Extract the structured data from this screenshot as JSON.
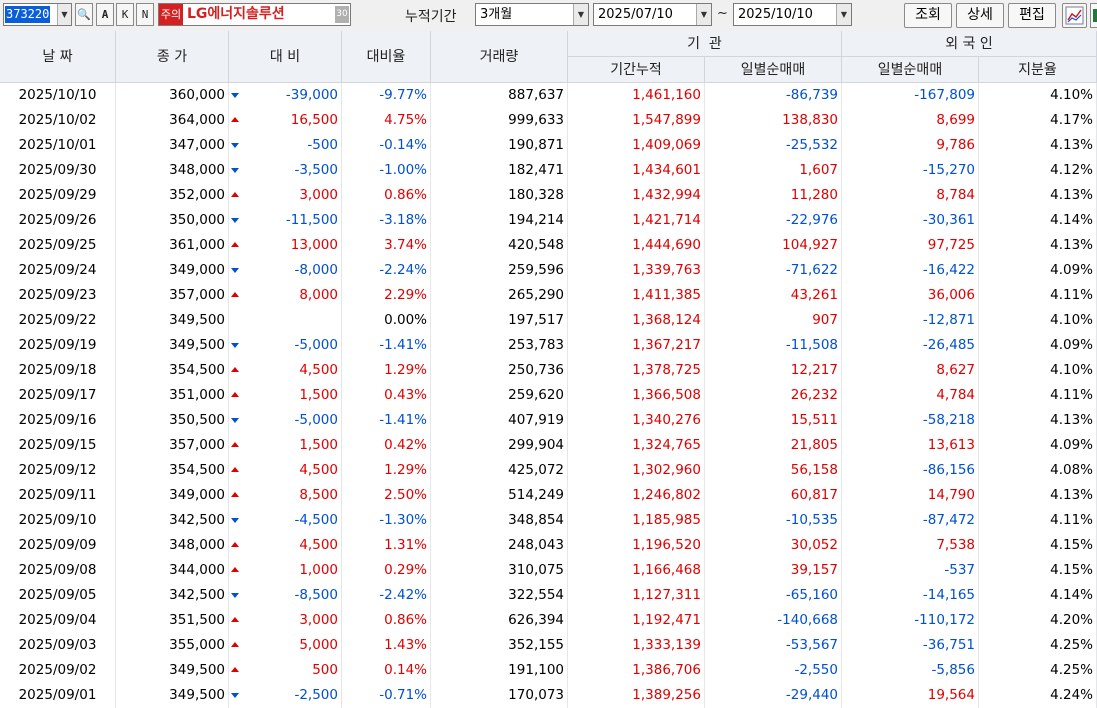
{
  "toolbar": {
    "code": "373220",
    "buttons": {
      "search": "🔍",
      "a": "A",
      "k": "K",
      "n": "N"
    },
    "caution": "주의",
    "name": "LG에너지솔루션",
    "name_btn": "30",
    "period_label": "누적기간",
    "period": "3개월",
    "start_date": "2025/07/10",
    "tilde": "~",
    "end_date": "2025/10/10",
    "query": "조회",
    "detail": "상세",
    "edit": "편집"
  },
  "colors": {
    "up": "#e00000",
    "down": "#0050d0",
    "header_bg": "#eef1f5"
  },
  "headers": {
    "date": "날 짜",
    "close": "종 가",
    "change": "대 비",
    "rate": "대비율",
    "volume": "거래량",
    "inst": "기  관",
    "inst_cum": "기간누적",
    "inst_daily": "일별순매매",
    "foreign": "외 국 인",
    "frgn_daily": "일별순매매",
    "frgn_share": "지분율"
  },
  "rows": [
    {
      "d": "2025/10/10",
      "c": "360,000",
      "dir": "down",
      "chg": "-39,000",
      "r": "-9.77%",
      "v": "887,637",
      "ic": "1,461,160",
      "id": "-86,739",
      "fd": "-167,809",
      "fs": "4.10%"
    },
    {
      "d": "2025/10/02",
      "c": "364,000",
      "dir": "up",
      "chg": "16,500",
      "r": "4.75%",
      "v": "999,633",
      "ic": "1,547,899",
      "id": "138,830",
      "fd": "8,699",
      "fs": "4.17%"
    },
    {
      "d": "2025/10/01",
      "c": "347,000",
      "dir": "down",
      "chg": "-500",
      "r": "-0.14%",
      "v": "190,871",
      "ic": "1,409,069",
      "id": "-25,532",
      "fd": "9,786",
      "fs": "4.13%"
    },
    {
      "d": "2025/09/30",
      "c": "348,000",
      "dir": "down",
      "chg": "-3,500",
      "r": "-1.00%",
      "v": "182,471",
      "ic": "1,434,601",
      "id": "1,607",
      "fd": "-15,270",
      "fs": "4.12%"
    },
    {
      "d": "2025/09/29",
      "c": "352,000",
      "dir": "up",
      "chg": "3,000",
      "r": "0.86%",
      "v": "180,328",
      "ic": "1,432,994",
      "id": "11,280",
      "fd": "8,784",
      "fs": "4.13%"
    },
    {
      "d": "2025/09/26",
      "c": "350,000",
      "dir": "down",
      "chg": "-11,500",
      "r": "-3.18%",
      "v": "194,214",
      "ic": "1,421,714",
      "id": "-22,976",
      "fd": "-30,361",
      "fs": "4.14%"
    },
    {
      "d": "2025/09/25",
      "c": "361,000",
      "dir": "up",
      "chg": "13,000",
      "r": "3.74%",
      "v": "420,548",
      "ic": "1,444,690",
      "id": "104,927",
      "fd": "97,725",
      "fs": "4.13%"
    },
    {
      "d": "2025/09/24",
      "c": "349,000",
      "dir": "down",
      "chg": "-8,000",
      "r": "-2.24%",
      "v": "259,596",
      "ic": "1,339,763",
      "id": "-71,622",
      "fd": "-16,422",
      "fs": "4.09%"
    },
    {
      "d": "2025/09/23",
      "c": "357,000",
      "dir": "up",
      "chg": "8,000",
      "r": "2.29%",
      "v": "265,290",
      "ic": "1,411,385",
      "id": "43,261",
      "fd": "36,006",
      "fs": "4.11%"
    },
    {
      "d": "2025/09/22",
      "c": "349,500",
      "dir": "none",
      "chg": "",
      "r": "0.00%",
      "v": "197,517",
      "ic": "1,368,124",
      "id": "907",
      "fd": "-12,871",
      "fs": "4.10%"
    },
    {
      "d": "2025/09/19",
      "c": "349,500",
      "dir": "down",
      "chg": "-5,000",
      "r": "-1.41%",
      "v": "253,783",
      "ic": "1,367,217",
      "id": "-11,508",
      "fd": "-26,485",
      "fs": "4.09%"
    },
    {
      "d": "2025/09/18",
      "c": "354,500",
      "dir": "up",
      "chg": "4,500",
      "r": "1.29%",
      "v": "250,736",
      "ic": "1,378,725",
      "id": "12,217",
      "fd": "8,627",
      "fs": "4.10%"
    },
    {
      "d": "2025/09/17",
      "c": "351,000",
      "dir": "up",
      "chg": "1,500",
      "r": "0.43%",
      "v": "259,620",
      "ic": "1,366,508",
      "id": "26,232",
      "fd": "4,784",
      "fs": "4.11%"
    },
    {
      "d": "2025/09/16",
      "c": "350,500",
      "dir": "down",
      "chg": "-5,000",
      "r": "-1.41%",
      "v": "407,919",
      "ic": "1,340,276",
      "id": "15,511",
      "fd": "-58,218",
      "fs": "4.13%"
    },
    {
      "d": "2025/09/15",
      "c": "357,000",
      "dir": "up",
      "chg": "1,500",
      "r": "0.42%",
      "v": "299,904",
      "ic": "1,324,765",
      "id": "21,805",
      "fd": "13,613",
      "fs": "4.09%"
    },
    {
      "d": "2025/09/12",
      "c": "354,500",
      "dir": "up",
      "chg": "4,500",
      "r": "1.29%",
      "v": "425,072",
      "ic": "1,302,960",
      "id": "56,158",
      "fd": "-86,156",
      "fs": "4.08%"
    },
    {
      "d": "2025/09/11",
      "c": "349,000",
      "dir": "up",
      "chg": "8,500",
      "r": "2.50%",
      "v": "514,249",
      "ic": "1,246,802",
      "id": "60,817",
      "fd": "14,790",
      "fs": "4.13%"
    },
    {
      "d": "2025/09/10",
      "c": "342,500",
      "dir": "down",
      "chg": "-4,500",
      "r": "-1.30%",
      "v": "348,854",
      "ic": "1,185,985",
      "id": "-10,535",
      "fd": "-87,472",
      "fs": "4.11%"
    },
    {
      "d": "2025/09/09",
      "c": "348,000",
      "dir": "up",
      "chg": "4,500",
      "r": "1.31%",
      "v": "248,043",
      "ic": "1,196,520",
      "id": "30,052",
      "fd": "7,538",
      "fs": "4.15%"
    },
    {
      "d": "2025/09/08",
      "c": "344,000",
      "dir": "up",
      "chg": "1,000",
      "r": "0.29%",
      "v": "310,075",
      "ic": "1,166,468",
      "id": "39,157",
      "fd": "-537",
      "fs": "4.15%"
    },
    {
      "d": "2025/09/05",
      "c": "342,500",
      "dir": "down",
      "chg": "-8,500",
      "r": "-2.42%",
      "v": "322,554",
      "ic": "1,127,311",
      "id": "-65,160",
      "fd": "-14,165",
      "fs": "4.14%"
    },
    {
      "d": "2025/09/04",
      "c": "351,500",
      "dir": "up",
      "chg": "3,000",
      "r": "0.86%",
      "v": "626,394",
      "ic": "1,192,471",
      "id": "-140,668",
      "fd": "-110,172",
      "fs": "4.20%"
    },
    {
      "d": "2025/09/03",
      "c": "355,000",
      "dir": "up",
      "chg": "5,000",
      "r": "1.43%",
      "v": "352,155",
      "ic": "1,333,139",
      "id": "-53,567",
      "fd": "-36,751",
      "fs": "4.25%"
    },
    {
      "d": "2025/09/02",
      "c": "349,500",
      "dir": "up",
      "chg": "500",
      "r": "0.14%",
      "v": "191,100",
      "ic": "1,386,706",
      "id": "-2,550",
      "fd": "-5,856",
      "fs": "4.25%"
    },
    {
      "d": "2025/09/01",
      "c": "349,500",
      "dir": "down",
      "chg": "-2,500",
      "r": "-0.71%",
      "v": "170,073",
      "ic": "1,389,256",
      "id": "-29,440",
      "fd": "19,564",
      "fs": "4.24%"
    }
  ]
}
